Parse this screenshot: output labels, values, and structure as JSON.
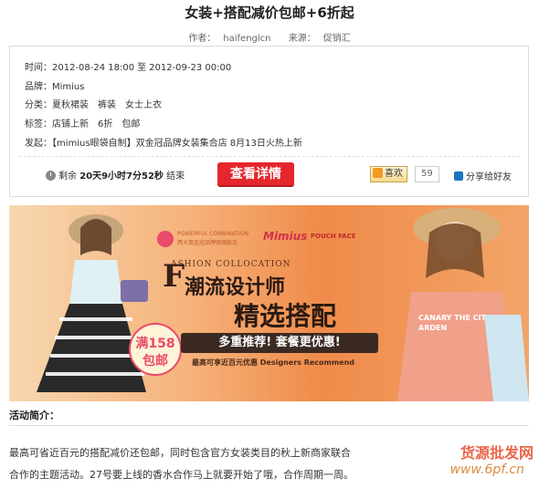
{
  "article": {
    "title": "女装+搭配减价包邮+6折起",
    "author_label": "作者：",
    "author": "haifenglcn",
    "source_label": "来源：",
    "source": "促销汇"
  },
  "info": {
    "time_label": "时间：",
    "time_start": "2012-08-24 18:00",
    "time_to": "至",
    "time_end": "2012-09-23 00:00",
    "brand_label": "品牌：",
    "brand": "Mimius",
    "category_label": "分类：",
    "categories": [
      "夏秋裙装",
      "裤装",
      "女士上衣"
    ],
    "tags_label": "标签：",
    "tags": [
      "店铺上新",
      "6折",
      "包邮"
    ],
    "origin_label": "发起：",
    "origin": "【mimius眼袋自制】双金冠品牌女装集合店  8月13日火热上新"
  },
  "countdown": {
    "prefix": "剩余",
    "value": "20天9小时7分52秒",
    "suffix": "结束"
  },
  "detail_button": "查看详情",
  "like": {
    "label": "喜欢",
    "count": "59"
  },
  "share_label": "分享给好友",
  "banner": {
    "small_logo_text": "POWERFUL COMBINATION",
    "small_logo_sub": "两大双金冠品牌强强联合",
    "brand_mimius": "Mimius",
    "pouch_face": "POUCH FACE",
    "fashion": "ASHION COLLOCATION",
    "big_f": "F",
    "headline1": "潮流设计师",
    "headline2": "精选搭配",
    "tagline": "多重推荐! 套餐更优惠!",
    "sub_tagline": "最高可享近百元优惠 Designers Recommend",
    "badge_line1": "满158",
    "badge_line2": "包邮",
    "shirt_text": "CANARY THE CIT ARDEN"
  },
  "section_title": "活动简介：",
  "intro_line1": "最高可省近百元的搭配减价还包邮，同时包含官方女装类目的秋上新商家联合",
  "intro_line2": "合作的主题活动。27号要上线的香水合作马上就要开始了哦，合作周期一周。",
  "watermark1": "货源批发网",
  "watermark2": "www.6pf.cn",
  "colors": {
    "button_red": "#e5262c",
    "banner_orange": "#f0934a",
    "accent_pink": "#e94a6a"
  }
}
